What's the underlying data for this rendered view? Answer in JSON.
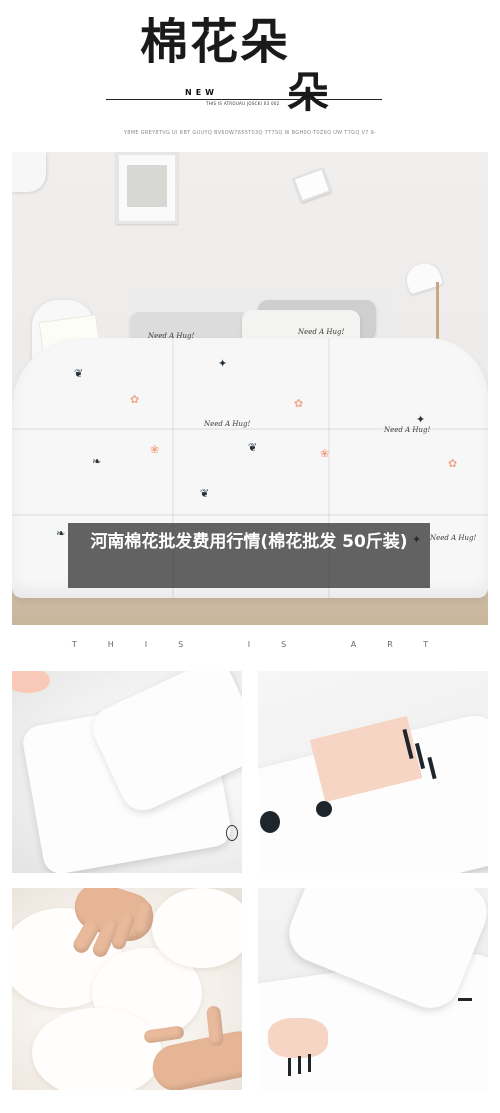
{
  "header": {
    "title_main": "棉花朵",
    "title_sub": "朵",
    "new_label": "NEW",
    "tiny_tag": "THIS IS ATROUAU JOSCKI 03 002",
    "code_line": "Y8ME GREY8TVG UI RBT GUUYQ BV6OW7655T03Q 7T7SQ W BGH0Q-T0Z6Q UW T7GQ V7 9-"
  },
  "hero": {
    "motifs": {
      "script_text": "Need A Hug!"
    }
  },
  "caption": {
    "text": "河南棉花批发费用行情(棉花批发 50斤装)"
  },
  "divider": {
    "text": "THIS IS ART"
  },
  "colors": {
    "accent_pink": "#f0a88a",
    "motif_dark": "#2f3a44",
    "caption_bg": "#282828"
  }
}
